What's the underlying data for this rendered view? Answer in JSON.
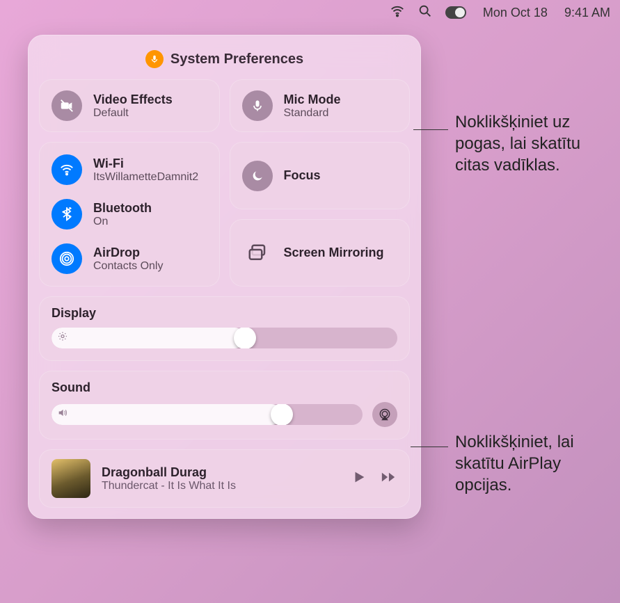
{
  "menubar": {
    "date": "Mon Oct 18",
    "time": "9:41 AM"
  },
  "panel": {
    "title": "System Preferences"
  },
  "tiles": {
    "video_effects": {
      "label": "Video Effects",
      "sub": "Default"
    },
    "mic_mode": {
      "label": "Mic Mode",
      "sub": "Standard"
    },
    "wifi": {
      "label": "Wi-Fi",
      "sub": "ItsWillametteDamnit2"
    },
    "bluetooth": {
      "label": "Bluetooth",
      "sub": "On"
    },
    "airdrop": {
      "label": "AirDrop",
      "sub": "Contacts Only"
    },
    "focus": {
      "label": "Focus"
    },
    "screen_mirroring": {
      "label": "Screen Mirroring"
    }
  },
  "sliders": {
    "display": {
      "label": "Display",
      "value_pct": 56
    },
    "sound": {
      "label": "Sound",
      "value_pct": 74
    }
  },
  "now_playing": {
    "title": "Dragonball Durag",
    "artist": "Thundercat - It Is What It Is"
  },
  "callouts": {
    "mic": "Noklikšķiniet uz pogas, lai skatītu citas vadīklas.",
    "airplay": "Noklikšķiniet, lai skatītu AirPlay opcijas."
  }
}
